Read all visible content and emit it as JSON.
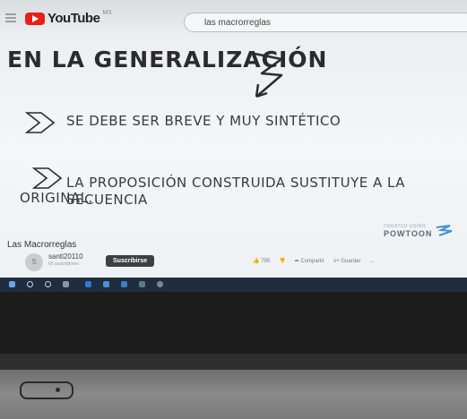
{
  "youtube": {
    "logo_text": "YouTube",
    "logo_sup": "MX",
    "search_value": "las macrorreglas"
  },
  "slide": {
    "title": "EN LA GENERALIZACIÓN",
    "bullet1": "SE DEBE SER BREVE Y MUY SINTÉTICO",
    "bullet2_line1": "LA PROPOSICIÓN CONSTRUIDA SUSTITUYE A LA SECUENCIA",
    "bullet2_line2": "ORIGINAL.",
    "watermark": "POWTOON",
    "watermark_small": "CREATED USING"
  },
  "video": {
    "title": "Las Macrorreglas",
    "channel": "santi20110",
    "subscribers": "65 suscriptores",
    "subscribe_label": "Suscribirse",
    "likes": "795",
    "share_label": "Compartir",
    "save_label": "Guardar",
    "more_label": "..."
  },
  "colors": {
    "youtube_red": "#e62117",
    "taskbar": "#1f2d3e"
  }
}
